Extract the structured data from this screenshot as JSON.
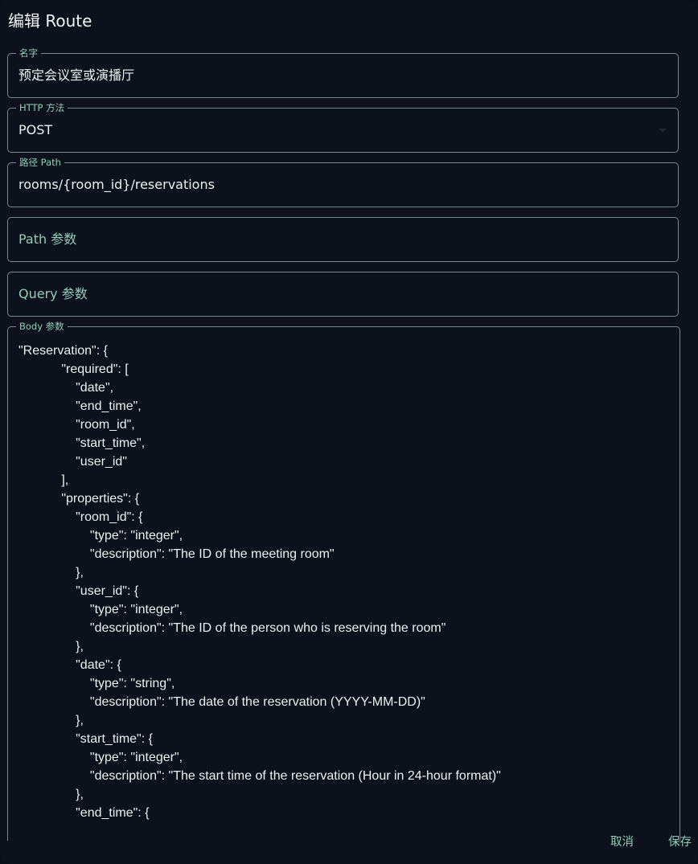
{
  "dialog": {
    "title": "编辑 Route"
  },
  "form": {
    "name": {
      "label": "名字",
      "value": "预定会议室或演播厅"
    },
    "method": {
      "label": "HTTP 方法",
      "value": "POST"
    },
    "path": {
      "label": "路径 Path",
      "value": "rooms/{room_id}/reservations"
    },
    "path_params": {
      "placeholder": "Path 参数"
    },
    "query_params": {
      "placeholder": "Query 参数"
    },
    "body_params": {
      "label": "Body 参数",
      "value": "\"Reservation\": {\n            \"required\": [\n                \"date\",\n                \"end_time\",\n                \"room_id\",\n                \"start_time\",\n                \"user_id\"\n            ],\n            \"properties\": {\n                \"room_id\": {\n                    \"type\": \"integer\",\n                    \"description\": \"The ID of the meeting room\"\n                },\n                \"user_id\": {\n                    \"type\": \"integer\",\n                    \"description\": \"The ID of the person who is reserving the room\"\n                },\n                \"date\": {\n                    \"type\": \"string\",\n                    \"description\": \"The date of the reservation (YYYY-MM-DD)\"\n                },\n                \"start_time\": {\n                    \"type\": \"integer\",\n                    \"description\": \"The start time of the reservation (Hour in 24-hour format)\"\n                },\n                \"end_time\": {"
    }
  },
  "actions": {
    "cancel_label": "取消",
    "save_label": "保存"
  }
}
